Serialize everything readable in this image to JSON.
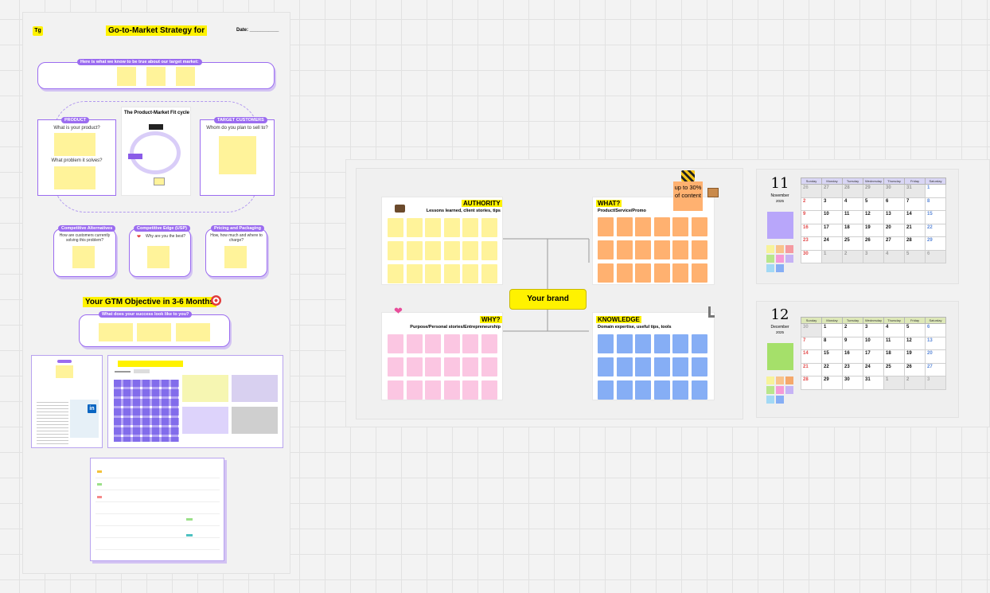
{
  "gtm": {
    "logo": "Tg",
    "title": "Go-to-Market Strategy for",
    "date_label": "Date: ___________",
    "truths_pill": "Here is what we know to be true about our target market:",
    "product_pill": "PRODUCT",
    "product_q1": "What is your product?",
    "product_q2": "What problem it solves?",
    "pmf_title": "The Product-Market Fit cycle",
    "target_pill": "TARGET CUSTOMERS",
    "target_q": "Whom do you plan to sell to?",
    "alt_pill": "Competitive Alternatives",
    "alt_q": "How are customers currently solving this problem?",
    "edge_pill": "Competitive Edge (USP)",
    "edge_q": "Why are you the best?",
    "price_pill": "Pricing and Packaging",
    "price_q": "How, how much and where to charge?",
    "objective_title": "Your GTM Objective in 3-6 Months",
    "success_pill": "What does your success look like to you?"
  },
  "brand": {
    "center": "Your brand",
    "authority_title": "AUTHORITY",
    "authority_sub": "Lessons learned, client stories, tips",
    "what_title": "WHAT?",
    "what_sub": "Product/Service/Promo",
    "what_note": "up to 30% of content",
    "why_title": "WHY?",
    "why_sub": "Purpose/Personal stories/Entrepreneurship",
    "knowledge_title": "KNOWLEDGE",
    "knowledge_sub": "Domain expertise, useful tips, tools",
    "colors": {
      "authority": "#fff39a",
      "what": "#ffb170",
      "why": "#fbc6e2",
      "knowledge": "#86aef5"
    }
  },
  "calendars": [
    {
      "day": "11",
      "month": "November",
      "year": "2025",
      "weekdays": [
        "Sunday",
        "Monday",
        "Tuesday",
        "Wednesday",
        "Thursday",
        "Friday",
        "Saturday"
      ],
      "weeks": [
        [
          "26",
          "27",
          "28",
          "29",
          "30",
          "31",
          "1"
        ],
        [
          "2",
          "3",
          "4",
          "5",
          "6",
          "7",
          "8"
        ],
        [
          "9",
          "10",
          "11",
          "12",
          "13",
          "14",
          "15"
        ],
        [
          "16",
          "17",
          "18",
          "19",
          "20",
          "21",
          "22"
        ],
        [
          "23",
          "24",
          "25",
          "26",
          "27",
          "28",
          "29"
        ],
        [
          "30",
          "1",
          "2",
          "3",
          "4",
          "5",
          "6"
        ]
      ]
    },
    {
      "day": "12",
      "month": "December",
      "year": "2025",
      "weekdays": [
        "Sunday",
        "Monday",
        "Tuesday",
        "Wednesday",
        "Thursday",
        "Friday",
        "Saturday"
      ],
      "weeks": [
        [
          "30",
          "1",
          "2",
          "3",
          "4",
          "5",
          "6"
        ],
        [
          "7",
          "8",
          "9",
          "10",
          "11",
          "12",
          "13"
        ],
        [
          "14",
          "15",
          "16",
          "17",
          "18",
          "19",
          "20"
        ],
        [
          "21",
          "22",
          "23",
          "24",
          "25",
          "26",
          "27"
        ],
        [
          "28",
          "29",
          "30",
          "31",
          "1",
          "2",
          "3"
        ]
      ]
    }
  ]
}
